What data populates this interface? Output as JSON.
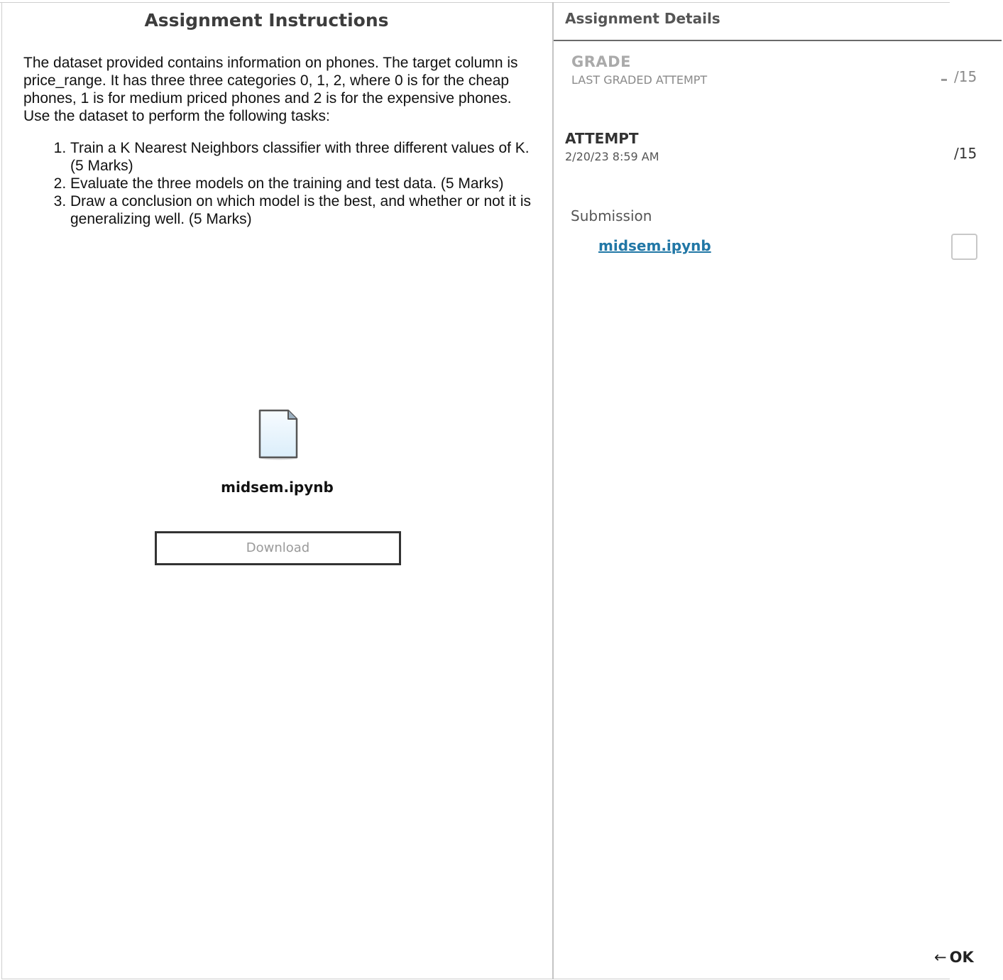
{
  "instructions_panel": {
    "title": "Assignment Instructions",
    "description": "The dataset provided contains information on phones. The target column is price_range. It has three three categories 0, 1, 2, where 0 is for the cheap phones, 1 is for medium priced phones and 2 is for the expensive phones. Use the dataset to perform the following tasks:",
    "tasks": [
      "Train a K Nearest Neighbors classifier with three different values of K. (5 Marks)",
      "Evaluate the three models on the training and test data. (5 Marks)",
      "Draw a conclusion on which model is the best, and whether or not it is generalizing well. (5 Marks)"
    ],
    "attachment": {
      "icon": "file-icon",
      "file_name": "midsem.ipynb",
      "download_label": "Download"
    }
  },
  "details_panel": {
    "title": "Assignment Details",
    "grade": {
      "label": "GRADE",
      "sublabel": "LAST GRADED ATTEMPT",
      "score": "/15"
    },
    "attempt": {
      "label": "ATTEMPT",
      "date": "2/20/23 8:59 AM",
      "score": "/15"
    },
    "submission": {
      "label": "Submission",
      "file_link": "midsem.ipynb"
    },
    "ok_button": {
      "arrow": "←",
      "label": "OK"
    }
  }
}
